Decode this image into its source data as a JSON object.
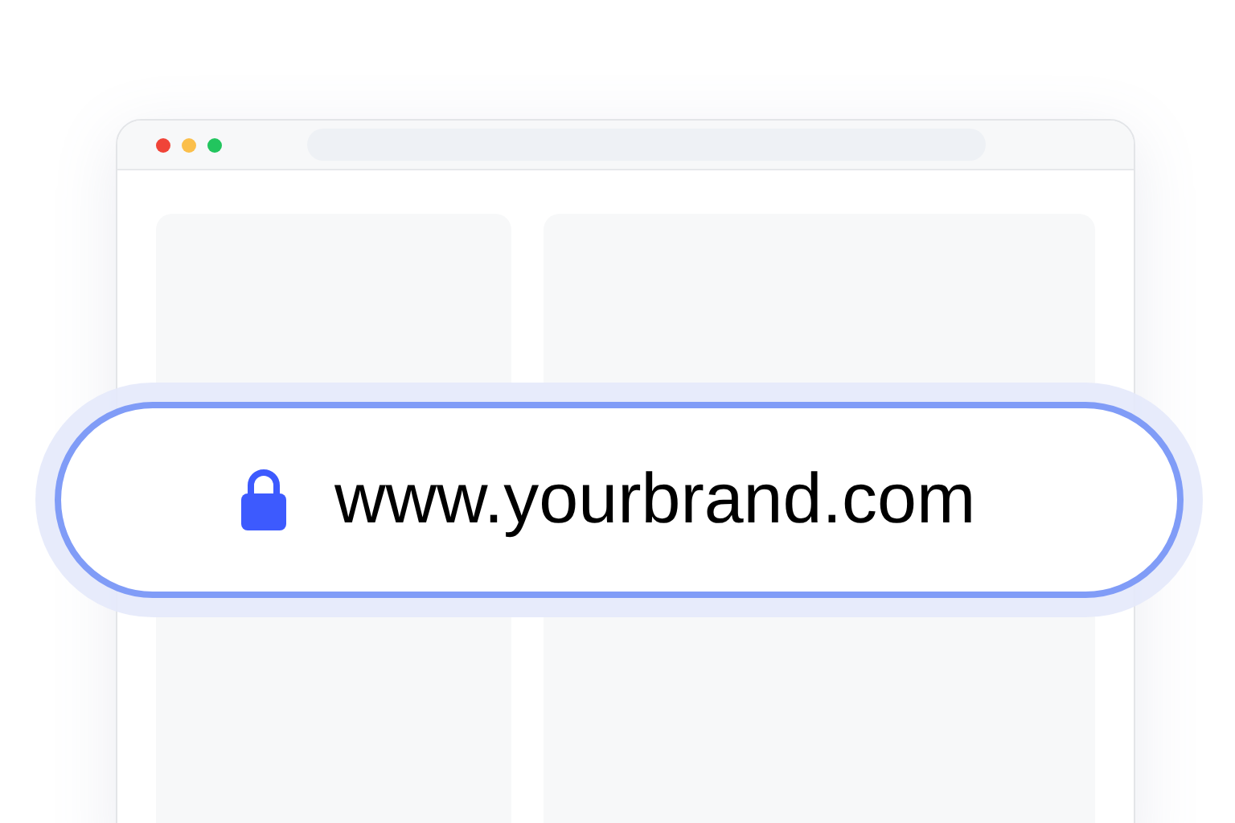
{
  "url_bar": {
    "url": "www.yourbrand.com"
  }
}
